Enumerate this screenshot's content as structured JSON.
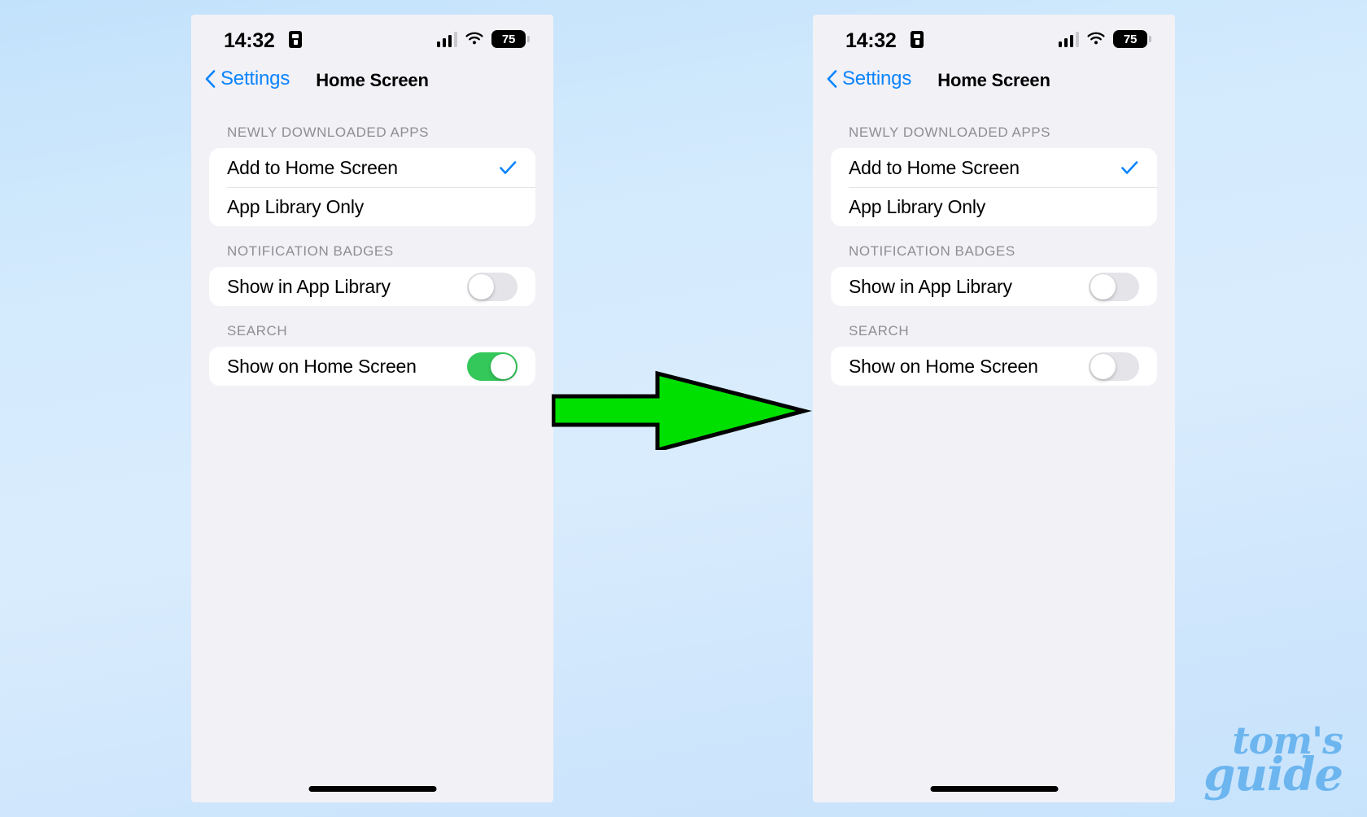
{
  "background": {
    "gradient_from": "#c2e2fb",
    "gradient_to": "#c7e3fc"
  },
  "accent": {
    "blue": "#0a84ff",
    "green_on": "#34c759",
    "toggle_off": "#e4e4e9",
    "arrow_green": "#00e000",
    "logo_blue": "#6cb5ef"
  },
  "status_bar": {
    "time": "14:32",
    "lock_icon": "lock-icon",
    "signal_icon": "cellular-signal-icon",
    "wifi_icon": "wifi-icon",
    "battery_level": "75"
  },
  "nav": {
    "back_label": "Settings",
    "back_icon": "chevron-left-icon",
    "title": "Home Screen"
  },
  "sections": {
    "newly_downloaded": {
      "header": "NEWLY DOWNLOADED APPS",
      "rows": [
        {
          "label": "Add to Home Screen",
          "checked": true
        },
        {
          "label": "App Library Only",
          "checked": false
        }
      ]
    },
    "notification_badges": {
      "header": "NOTIFICATION BADGES",
      "row_label": "Show in App Library"
    },
    "search": {
      "header": "SEARCH",
      "row_label": "Show on Home Screen"
    }
  },
  "phones": {
    "left": {
      "name": "before-state",
      "show_in_app_library": "off",
      "show_on_home_screen": "on"
    },
    "right": {
      "name": "after-state",
      "show_in_app_library": "off",
      "show_on_home_screen": "off"
    }
  },
  "arrow": {
    "icon": "right-arrow-icon",
    "direction": "right"
  },
  "watermark": {
    "line1": "tom's",
    "line2": "guide"
  }
}
